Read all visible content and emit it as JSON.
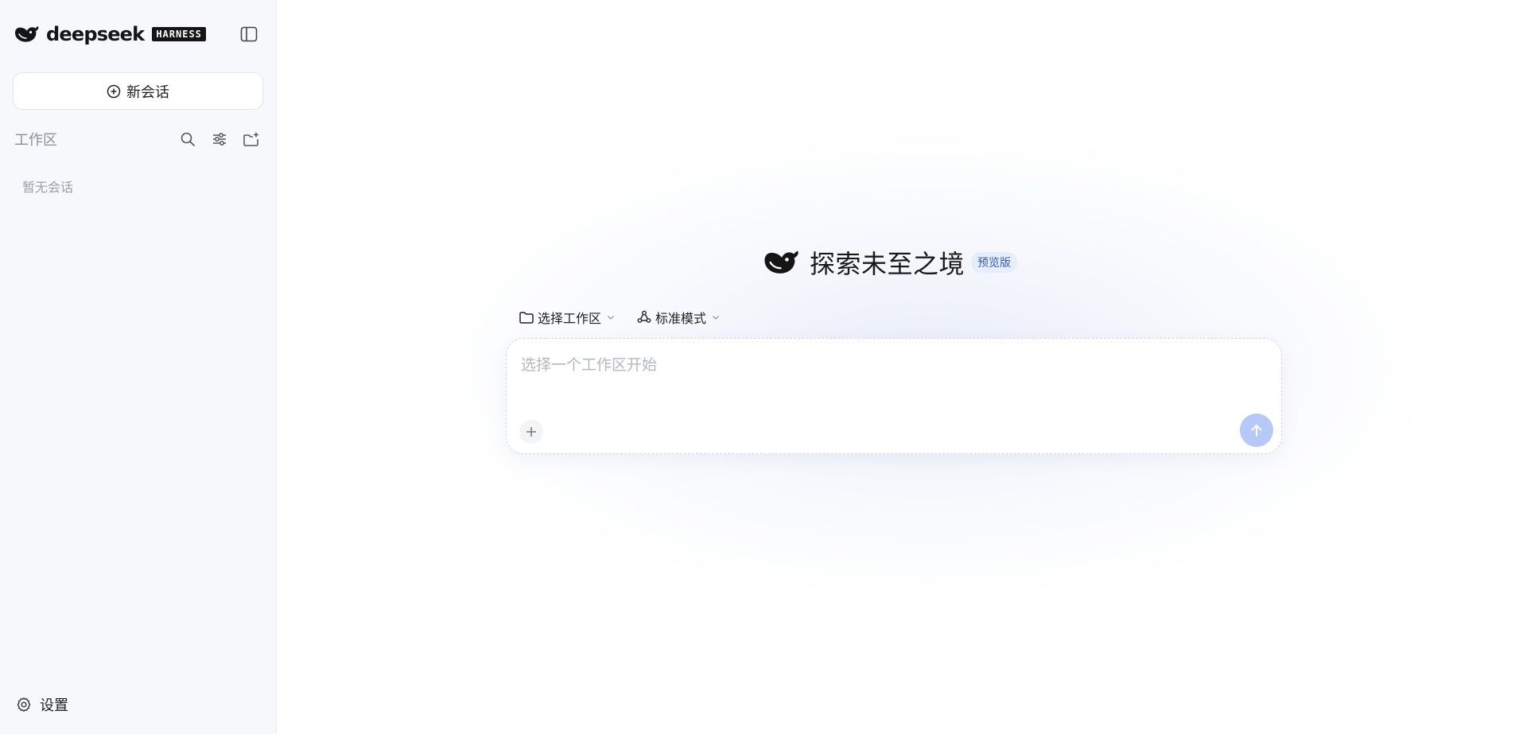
{
  "sidebar": {
    "brand_name": "deepseek",
    "brand_badge": "HARNESS",
    "new_chat_label": "新会话",
    "workspace_title": "工作区",
    "empty_text": "暂无会话",
    "settings_label": "设置",
    "icons": [
      "whale-logo-icon",
      "sidebar-toggle-icon",
      "plus-circle-icon",
      "search-icon",
      "sliders-icon",
      "new-folder-icon",
      "gear-icon"
    ]
  },
  "main": {
    "hero_title": "探索未至之境",
    "hero_badge": "预览版",
    "workspace_selector_label": "选择工作区",
    "mode_selector_label": "标准模式",
    "input_placeholder": "选择一个工作区开始",
    "icons": [
      "whale-logo-icon",
      "folder-icon",
      "mode-icon",
      "chevron-down-icon",
      "plus-icon",
      "arrow-up-icon"
    ]
  },
  "colors": {
    "sidebar_bg": "#f6f8fb",
    "accent_send_disabled": "#b6c8f6",
    "badge_bg": "#e6edfb",
    "badge_text": "#3b5bb3"
  }
}
